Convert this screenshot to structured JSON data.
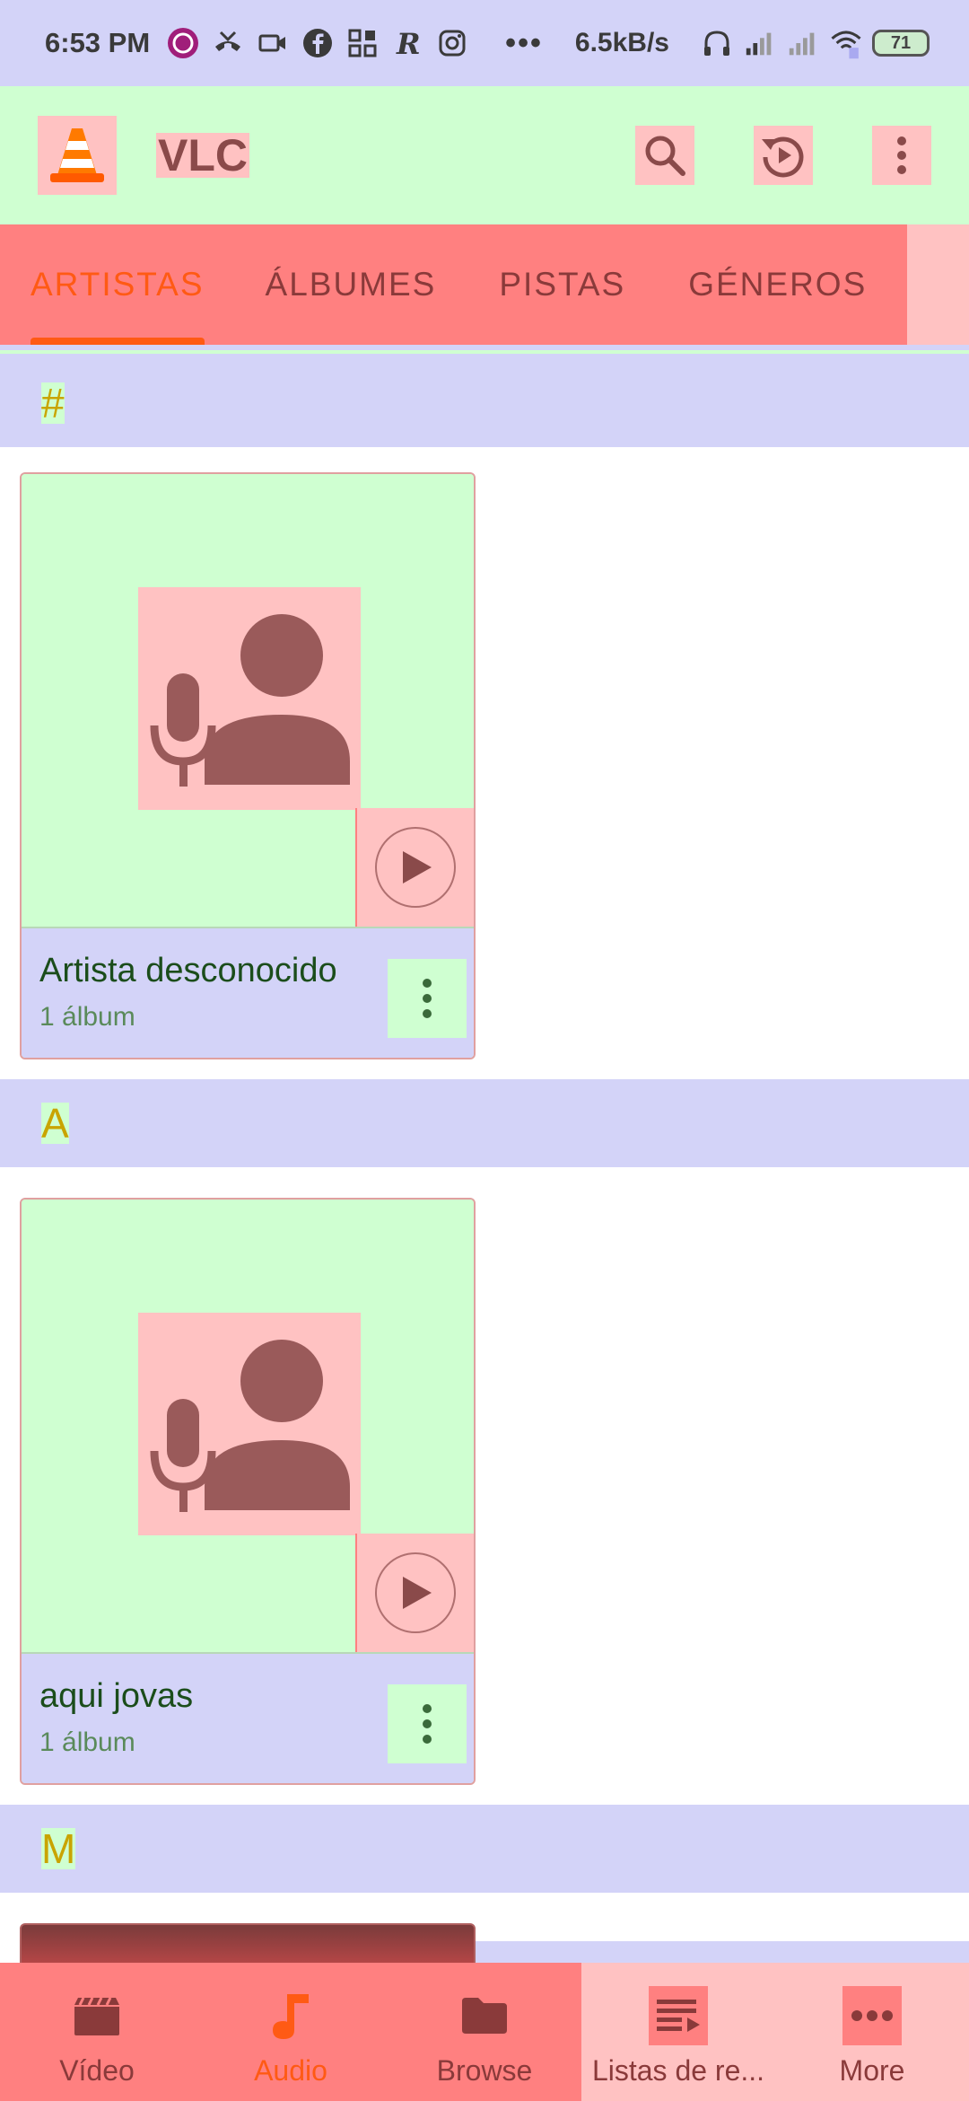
{
  "status_bar": {
    "time": "6:53 PM",
    "more": "•••",
    "speed": "6.5kB/s",
    "battery": "71"
  },
  "app_bar": {
    "title": "VLC",
    "icons": [
      "vlc-logo-icon",
      "search-icon",
      "history-icon",
      "more-vert-icon"
    ]
  },
  "tabs": [
    {
      "label": "ARTISTAS",
      "active": true
    },
    {
      "label": "ÁLBUMES",
      "active": false
    },
    {
      "label": "PISTAS",
      "active": false
    },
    {
      "label": "GÉNEROS",
      "active": false
    }
  ],
  "sections": [
    {
      "letter": "#",
      "artist": {
        "name": "Artista desconocido",
        "subtitle": "1 álbum"
      }
    },
    {
      "letter": "A",
      "artist": {
        "name": "aqui jovas",
        "subtitle": "1 álbum"
      }
    },
    {
      "letter": "M"
    }
  ],
  "bottom_nav": [
    {
      "label": "Vídeo",
      "icon": "movie-icon",
      "active": false
    },
    {
      "label": "Audio",
      "icon": "music-note-icon",
      "active": true
    },
    {
      "label": "Browse",
      "icon": "folder-icon",
      "active": false
    },
    {
      "label": "Listas de re...",
      "icon": "playlist-icon",
      "active": false
    },
    {
      "label": "More",
      "icon": "more-horiz-icon",
      "active": false
    }
  ],
  "colors": {
    "accent": "#ff5a14",
    "section_letter": "#c9a400",
    "title_text": "#1b4d1b"
  }
}
